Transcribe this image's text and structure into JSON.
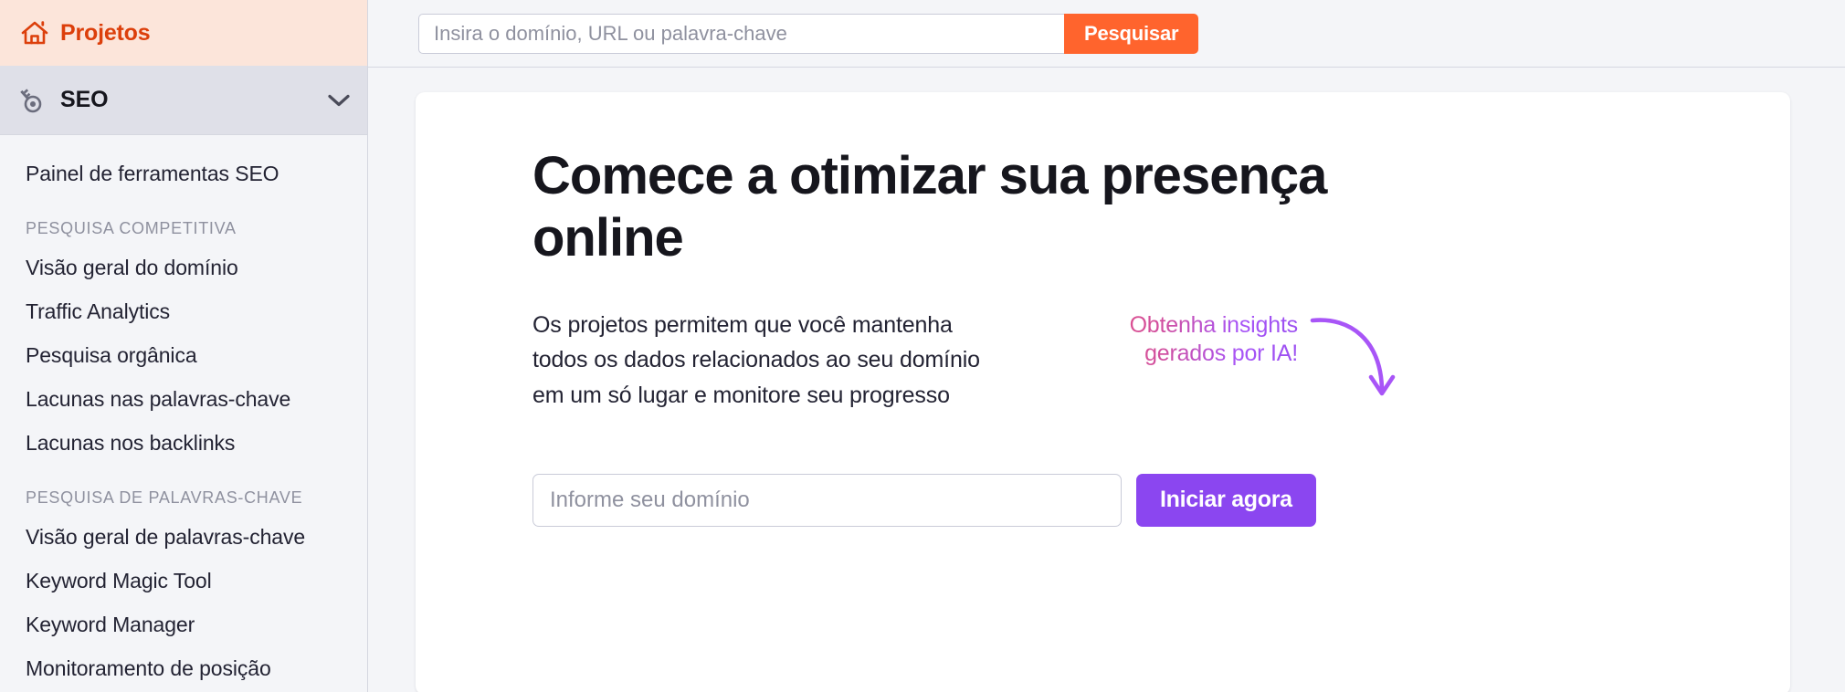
{
  "sidebar": {
    "projects": {
      "label": "Projetos",
      "icon": "home-icon",
      "color": "#dc3f0b",
      "background": "#fce5da"
    },
    "seo": {
      "label": "SEO",
      "icon": "key-icon",
      "chevron": "chevron-down-icon",
      "background": "#dfe0e8",
      "expanded": true
    },
    "items": [
      {
        "type": "link",
        "label": "Painel de ferramentas SEO"
      },
      {
        "type": "section",
        "label": "PESQUISA COMPETITIVA"
      },
      {
        "type": "link",
        "label": "Visão geral do domínio"
      },
      {
        "type": "link",
        "label": "Traffic Analytics"
      },
      {
        "type": "link",
        "label": "Pesquisa orgânica"
      },
      {
        "type": "link",
        "label": "Lacunas nas palavras-chave"
      },
      {
        "type": "link",
        "label": "Lacunas nos backlinks"
      },
      {
        "type": "section",
        "label": "PESQUISA DE PALAVRAS-CHAVE"
      },
      {
        "type": "link",
        "label": "Visão geral de palavras-chave"
      },
      {
        "type": "link",
        "label": "Keyword Magic Tool"
      },
      {
        "type": "link",
        "label": "Keyword Manager"
      },
      {
        "type": "link",
        "label": "Monitoramento de posição"
      }
    ]
  },
  "topbar": {
    "search": {
      "placeholder": "Insira o domínio, URL ou palavra-chave",
      "value": "",
      "button_label": "Pesquisar",
      "button_color": "#ff642d"
    }
  },
  "main": {
    "title": "Comece a otimizar sua presença online",
    "description": "Os projetos permitem que você mantenha todos os dados relacionados ao seu domínio em um só lugar e monitore seu progresso",
    "annotation": {
      "line1": "Obtenha insights",
      "line2": "gerados por IA!",
      "gradient_start": "#e9527f",
      "gradient_end": "#9b4ff0",
      "arrow": "curved-arrow-down-icon"
    },
    "form": {
      "domain_placeholder": "Informe seu domínio",
      "domain_value": "",
      "submit_label": "Iniciar agora",
      "submit_color": "#8b46f0"
    }
  }
}
